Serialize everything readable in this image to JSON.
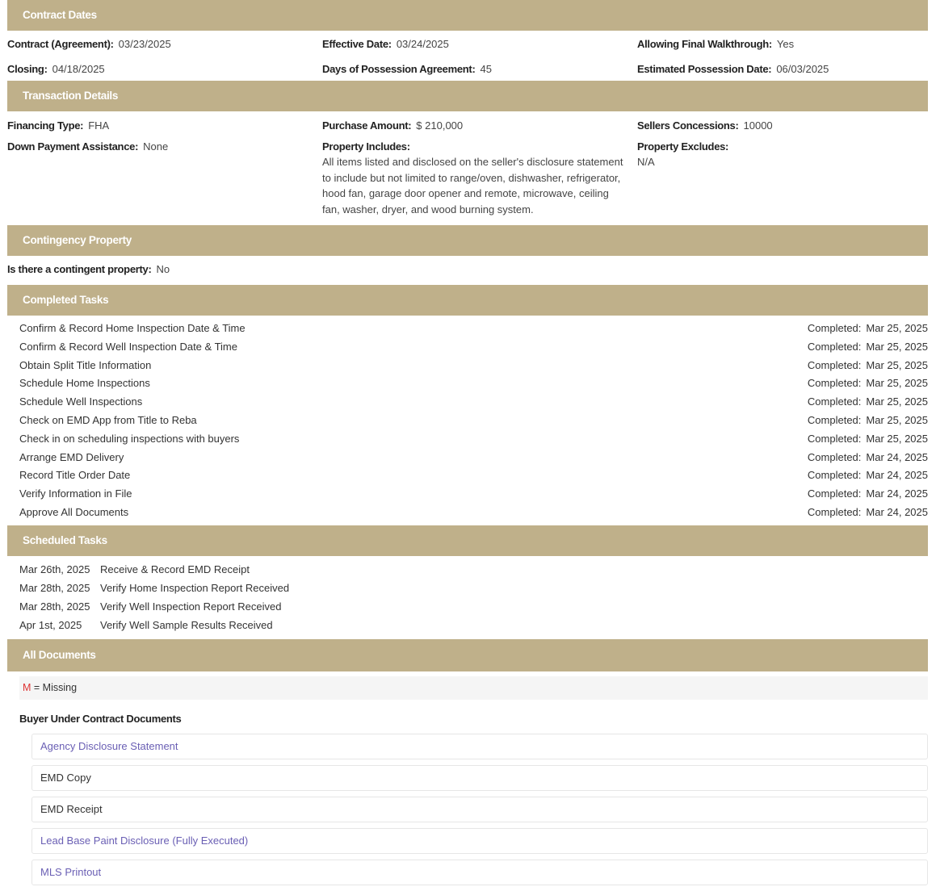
{
  "contract_dates": {
    "header": "Contract Dates",
    "contract_label": "Contract (Agreement):",
    "contract_value": "03/23/2025",
    "effective_label": "Effective Date:",
    "effective_value": "03/24/2025",
    "walkthrough_label": "Allowing Final Walkthrough:",
    "walkthrough_value": "Yes",
    "closing_label": "Closing:",
    "closing_value": "04/18/2025",
    "possession_days_label": "Days of Possession Agreement:",
    "possession_days_value": "45",
    "est_possession_label": "Estimated Possession Date:",
    "est_possession_value": "06/03/2025"
  },
  "transaction": {
    "header": "Transaction Details",
    "financing_label": "Financing Type:",
    "financing_value": "FHA",
    "purchase_label": "Purchase Amount:",
    "purchase_value": "$ 210,000",
    "concessions_label": "Sellers Concessions:",
    "concessions_value": "10000",
    "dpa_label": "Down Payment Assistance:",
    "dpa_value": "None",
    "includes_label": "Property Includes:",
    "includes_value": "All items listed and disclosed on the seller's disclosure statement to include but not limited to range/oven, dishwasher, refrigerator, hood fan, garage door opener and remote, microwave, ceiling fan, washer, dryer, and wood burning system.",
    "excludes_label": "Property Excludes:",
    "excludes_value": "N/A"
  },
  "contingency": {
    "header": "Contingency Property",
    "label": "Is there a contingent property:",
    "value": "No"
  },
  "completed": {
    "header": "Completed Tasks",
    "completed_label": "Completed:",
    "tasks": [
      {
        "name": "Confirm & Record Home Inspection Date & Time",
        "date": "Mar 25, 2025"
      },
      {
        "name": "Confirm & Record Well Inspection Date & Time",
        "date": "Mar 25, 2025"
      },
      {
        "name": "Obtain Split Title Information",
        "date": "Mar 25, 2025"
      },
      {
        "name": "Schedule Home Inspections",
        "date": "Mar 25, 2025"
      },
      {
        "name": "Schedule Well Inspections",
        "date": "Mar 25, 2025"
      },
      {
        "name": "Check on EMD App from Title to Reba",
        "date": "Mar 25, 2025"
      },
      {
        "name": "Check in on scheduling inspections with buyers",
        "date": "Mar 25, 2025"
      },
      {
        "name": "Arrange EMD Delivery",
        "date": "Mar 24, 2025"
      },
      {
        "name": "Record Title Order Date",
        "date": "Mar 24, 2025"
      },
      {
        "name": "Verify Information in File",
        "date": "Mar 24, 2025"
      },
      {
        "name": "Approve All Documents",
        "date": "Mar 24, 2025"
      }
    ]
  },
  "scheduled": {
    "header": "Scheduled Tasks",
    "tasks": [
      {
        "date": "Mar 26th, 2025",
        "name": "Receive & Record EMD Receipt"
      },
      {
        "date": "Mar 28th, 2025",
        "name": "Verify Home Inspection Report Received"
      },
      {
        "date": "Mar 28th, 2025",
        "name": "Verify Well Inspection Report Received"
      },
      {
        "date": "Apr 1st, 2025",
        "name": "Verify Well Sample Results Received"
      }
    ]
  },
  "documents": {
    "header": "All Documents",
    "legend_mark": "M",
    "legend_text": "= Missing",
    "group_title": "Buyer Under Contract Documents",
    "items": [
      {
        "label": "Agency Disclosure Statement",
        "link": true
      },
      {
        "label": "EMD Copy",
        "link": false
      },
      {
        "label": "EMD Receipt",
        "link": false
      },
      {
        "label": "Lead Base Paint Disclosure (Fully Executed)",
        "link": true
      },
      {
        "label": "MLS Printout",
        "link": true
      }
    ]
  },
  "colors": {
    "header_bg": "#bfb08a",
    "link": "#6a5fb4",
    "missing": "#dd3333"
  }
}
